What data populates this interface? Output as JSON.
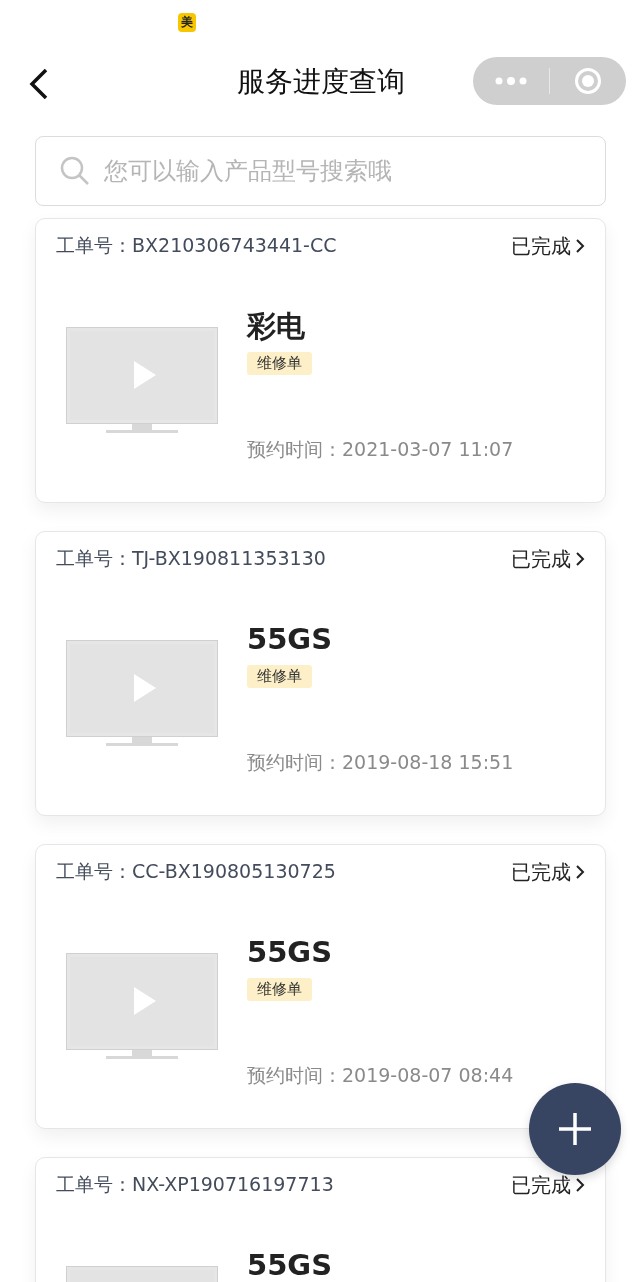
{
  "status_bar": {
    "app_badge": "美"
  },
  "nav": {
    "title": "服务进度查询"
  },
  "search": {
    "placeholder": "您可以输入产品型号搜索哦"
  },
  "orders": [
    {
      "order_label": "工单号：BX210306743441-CC",
      "status": "已完成",
      "product": "彩电",
      "tag": "维修单",
      "time": "预约时间：2021-03-07 11:07"
    },
    {
      "order_label": "工单号：TJ-BX190811353130",
      "status": "已完成",
      "product": "55GS",
      "tag": "维修单",
      "time": "预约时间：2019-08-18 15:51"
    },
    {
      "order_label": "工单号：CC-BX190805130725",
      "status": "已完成",
      "product": "55GS",
      "tag": "维修单",
      "time": "预约时间：2019-08-07 08:44"
    },
    {
      "order_label": "工单号：NX-XP190716197713",
      "status": "已完成",
      "product": "55GS"
    }
  ]
}
